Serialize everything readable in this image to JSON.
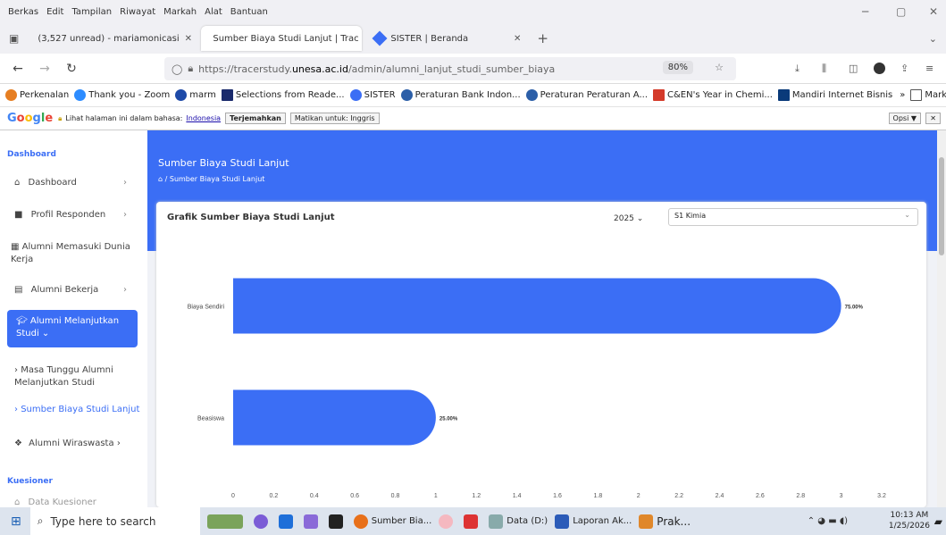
{
  "menubar": {
    "items": [
      "Berkas",
      "Edit",
      "Tampilan",
      "Riwayat",
      "Markah",
      "Alat",
      "Bantuan"
    ]
  },
  "tabs": [
    {
      "label": "(3,527 unread) - mariamonicasi",
      "icon_color": "#7b5cd6"
    },
    {
      "label": "Sumber Biaya Studi Lanjut | Trac",
      "icon_color": "#e8c24a"
    },
    {
      "label": "SISTER | Beranda",
      "icon_color": "#3b6ef5"
    }
  ],
  "url": {
    "prefix": "https://tracerstudy.",
    "domain": "unesa.ac.id",
    "path": "/admin/alumni_lanjut_studi_sumber_biaya",
    "zoom": "80%"
  },
  "bookmarks": [
    "Perkenalan",
    "Thank you - Zoom",
    "marm",
    "Selections from Reade...",
    "SISTER",
    "Peraturan Bank Indon...",
    "Peraturan Peraturan A...",
    "C&EN's Year in Chemi...",
    "Mandiri Internet Bisnis",
    "Markah Lain"
  ],
  "gtranslate": {
    "prompt": "Lihat halaman ini dalam bahasa:",
    "lang": "Indonesia",
    "translate": "Terjemahkan",
    "off": "Matikan untuk: Inggris",
    "options": "Opsi ▼"
  },
  "sidebar": {
    "header1": "Dashboard",
    "items": [
      {
        "label": "Dashboard",
        "icon": "home-icon"
      },
      {
        "label": "Profil Responden",
        "icon": "user-icon"
      },
      {
        "label": "Alumni Memasuki Dunia Kerja",
        "icon": "building-icon"
      },
      {
        "label": "Alumni Bekerja",
        "icon": "briefcase-icon"
      }
    ],
    "active": "Alumni Melanjutkan Studi",
    "sub": [
      "Masa Tunggu Alumni Melanjutkan Studi",
      "Sumber Biaya Studi Lanjut"
    ],
    "after": "Alumni Wiraswasta",
    "header2": "Kuesioner",
    "last": "Data Kuesioner"
  },
  "banner": {
    "title": "Sumber Biaya Studi Lanjut",
    "breadcrumb": "Sumber Biaya Studi Lanjut"
  },
  "card": {
    "title": "Grafik Sumber Biaya Studi Lanjut",
    "year": "2025",
    "program": "S1 Kimia"
  },
  "chart_data": {
    "type": "bar",
    "orientation": "horizontal",
    "categories": [
      "Biaya Sendiri",
      "Beasiswa"
    ],
    "values": [
      3.0,
      1.0
    ],
    "data_labels": [
      "75.00%",
      "25.00%"
    ],
    "xlim": [
      0,
      3.2
    ],
    "xticks": [
      "0",
      "0.2",
      "0.4",
      "0.6",
      "0.8",
      "1",
      "1.2",
      "1.4",
      "1.6",
      "1.8",
      "2",
      "2.2",
      "2.4",
      "2.6",
      "2.8",
      "3",
      "3.2"
    ],
    "color": "#3b6ef5"
  },
  "taskbar": {
    "search": "Type here to search",
    "apps": [
      "Sumber Bia...",
      "Data (D:)",
      "Laporan Ak...",
      "Prak..."
    ],
    "time": "10:13 AM",
    "date": "1/25/2026"
  }
}
